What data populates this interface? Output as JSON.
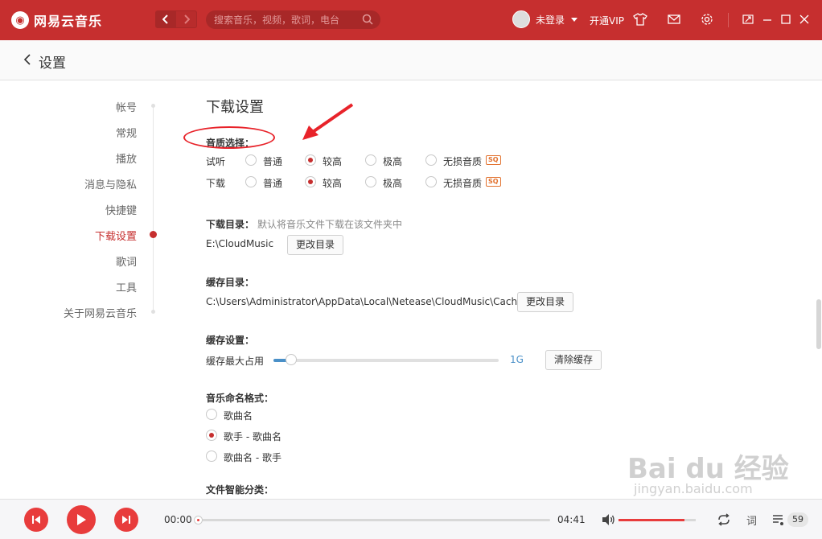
{
  "app": {
    "name": "网易云音乐",
    "brand_color": "#c62f2f"
  },
  "topbar": {
    "search_placeholder": "搜索音乐，视频，歌词，电台",
    "user_name": "未登录",
    "vip_label": "开通VIP"
  },
  "header": {
    "title": "设置"
  },
  "sidebar": {
    "items": [
      {
        "label": "帐号"
      },
      {
        "label": "常规"
      },
      {
        "label": "播放"
      },
      {
        "label": "消息与隐私"
      },
      {
        "label": "快捷键"
      },
      {
        "label": "下载设置",
        "active": true
      },
      {
        "label": "歌词"
      },
      {
        "label": "工具"
      },
      {
        "label": "关于网易云音乐"
      }
    ]
  },
  "download": {
    "section_title": "下载设置",
    "quality": {
      "label": "音质选择：",
      "rows": [
        {
          "label": "试听",
          "selected": "较高"
        },
        {
          "label": "下载",
          "selected": "较高"
        }
      ],
      "options": [
        "普通",
        "较高",
        "极高",
        "无损音质"
      ],
      "sq_badge": "SQ"
    },
    "dir": {
      "label": "下载目录：",
      "hint": "默认将音乐文件下载在该文件夹中",
      "path": "E:\\CloudMusic",
      "button": "更改目录"
    },
    "cache_dir": {
      "label": "缓存目录：",
      "path": "C:\\Users\\Administrator\\AppData\\Local\\Netease\\CloudMusic\\Cache",
      "button": "更改目录"
    },
    "cache_settings": {
      "label": "缓存设置：",
      "max_label": "缓存最大占用",
      "value": "1G",
      "slider_fraction": 0.08,
      "button": "清除缓存"
    },
    "naming": {
      "label": "音乐命名格式：",
      "options": [
        "歌曲名",
        "歌手 - 歌曲名",
        "歌曲名 - 歌手"
      ],
      "selected": "歌手 - 歌曲名"
    },
    "classify": {
      "label": "文件智能分类："
    }
  },
  "player": {
    "current_time": "00:00",
    "total_time": "04:41",
    "progress_fraction": 0.0,
    "volume_fraction": 0.85,
    "lyric_label": "词",
    "playlist_count": "59"
  },
  "watermark": {
    "text": "Bai du 经验",
    "sub": "jingyan.baidu.com"
  }
}
